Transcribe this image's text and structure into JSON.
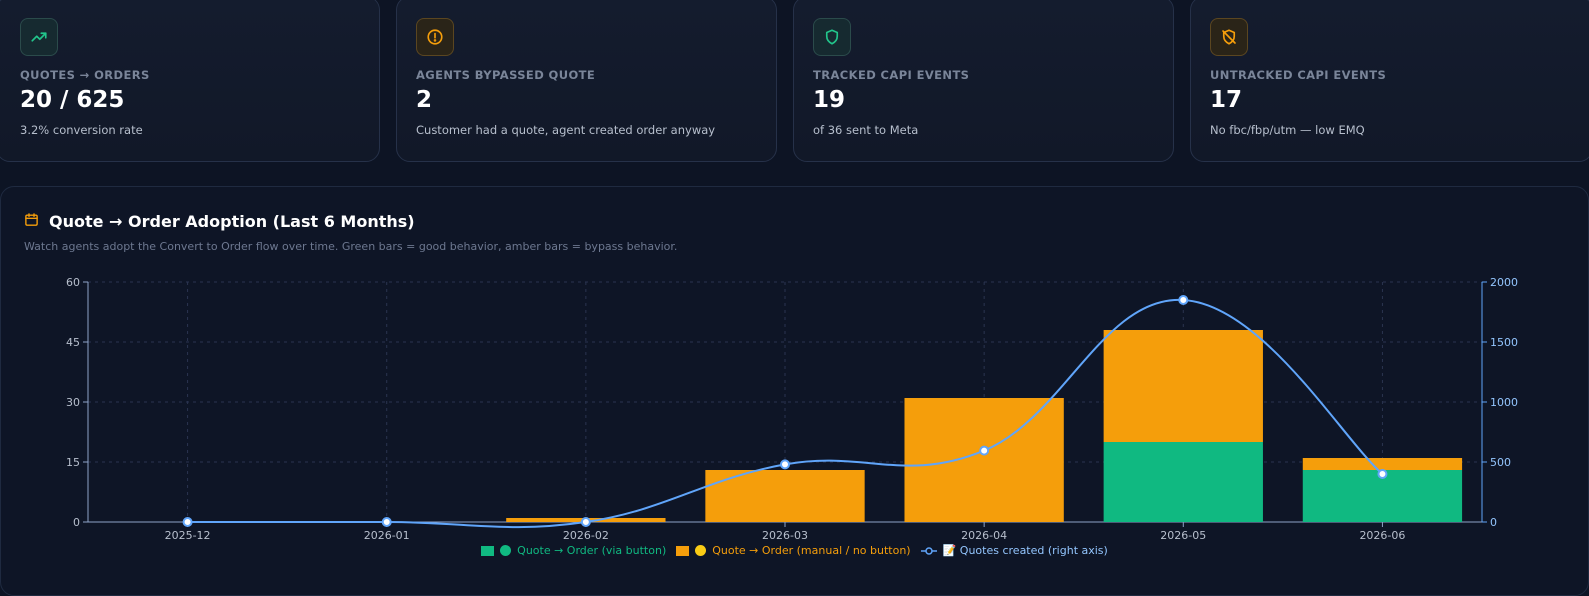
{
  "cards": [
    {
      "label": "QUOTES → ORDERS",
      "value": "20 / 625",
      "sub": "3.2% conversion rate",
      "icon": "trending-up-icon",
      "color": "#22c58b"
    },
    {
      "label": "AGENTS BYPASSED QUOTE",
      "value": "2",
      "sub": "Customer had a quote, agent created order anyway",
      "icon": "alert-circle-icon",
      "color": "#f59e0b"
    },
    {
      "label": "TRACKED CAPI EVENTS",
      "value": "19",
      "sub": "of 36 sent to Meta",
      "icon": "shield-check-icon",
      "color": "#22c58b"
    },
    {
      "label": "UNTRACKED CAPI EVENTS",
      "value": "17",
      "sub": "No fbc/fbp/utm — low EMQ",
      "icon": "shield-off-icon",
      "color": "#f59e0b"
    }
  ],
  "panel": {
    "title": "Quote → Order Adoption (Last 6 Months)",
    "subtitle": "Watch agents adopt the Convert to Order flow over time. Green bars = good behavior, amber bars = bypass behavior.",
    "icon": "calendar-icon"
  },
  "legend": {
    "green": "Quote → Order (via button)",
    "amber": "Quote → Order (manual / no button)",
    "line": "📝 Quotes created (right axis)"
  },
  "chart_data": {
    "type": "bar",
    "stacked": true,
    "categories": [
      "2025-12",
      "2026-01",
      "2026-02",
      "2026-03",
      "2026-04",
      "2026-05",
      "2026-06"
    ],
    "series": [
      {
        "name": "Quote → Order (via button)",
        "type": "bar",
        "axis": "left",
        "color": "#10b981",
        "values": [
          0,
          0,
          0,
          0,
          0,
          20,
          13
        ]
      },
      {
        "name": "Quote → Order (manual / no button)",
        "type": "bar",
        "axis": "left",
        "color": "#f59e0b",
        "values": [
          0,
          0,
          1,
          13,
          31,
          28,
          3
        ]
      },
      {
        "name": "Quotes created (right axis)",
        "type": "line",
        "axis": "right",
        "color": "#60a5fa",
        "values": [
          0,
          0,
          0,
          480,
          595,
          1850,
          400
        ]
      }
    ],
    "y_left": {
      "min": 0,
      "max": 60,
      "ticks": [
        0,
        15,
        30,
        45,
        60
      ]
    },
    "y_right": {
      "min": 0,
      "max": 2000,
      "ticks": [
        0,
        500,
        1000,
        1500,
        2000
      ]
    },
    "grid": true,
    "legend_position": "bottom-center"
  }
}
